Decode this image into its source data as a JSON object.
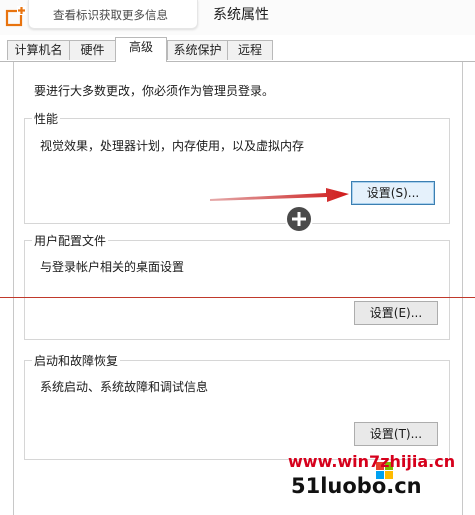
{
  "window": {
    "title": "系统属性"
  },
  "hint": {
    "label": "查看标识获取更多信息"
  },
  "tabs": [
    {
      "label": "计算机名"
    },
    {
      "label": "硬件"
    },
    {
      "label": "高级"
    },
    {
      "label": "系统保护"
    },
    {
      "label": "远程"
    }
  ],
  "active_tab": "高级",
  "intro": "要进行大多数更改，你必须作为管理员登录。",
  "performance": {
    "title": "性能",
    "description": "视觉效果，处理器计划，内存使用，以及虚拟内存",
    "button": "设置(S)..."
  },
  "user_profiles": {
    "title": "用户配置文件",
    "description": "与登录帐户相关的桌面设置",
    "button": "设置(E)..."
  },
  "startup_recovery": {
    "title": "启动和故障恢复",
    "description": "系统启动、系统故障和调试信息",
    "button": "设置(T)..."
  },
  "watermark": {
    "url": "www.win7zhijia.cn",
    "domain": "51luobo.cn"
  },
  "colors": {
    "accent_red": "#c0392b",
    "app_icon_orange": "#e8730e",
    "watermark_red": "#d6001c",
    "watermark_blue": "#3b6fc1"
  },
  "icons": [
    "app-icon",
    "arrow-annotation",
    "plus-circle-icon",
    "windows-logo"
  ]
}
